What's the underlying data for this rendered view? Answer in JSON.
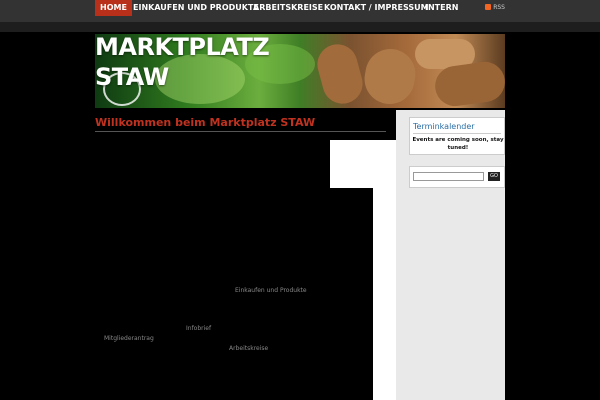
{
  "nav": {
    "items": [
      {
        "label": "HOME",
        "active": true
      },
      {
        "label": "EINKAUFEN UND PRODUKTE",
        "active": false
      },
      {
        "label": "ARBEITSKREISE",
        "active": false
      },
      {
        "label": "KONTAKT / IMPRESSUM",
        "active": false
      },
      {
        "label": "INTERN",
        "active": false
      }
    ],
    "rss_label": "RSS"
  },
  "site": {
    "title_line1": "MARKTPLATZ",
    "title_line2": "STAW"
  },
  "main": {
    "heading": "Willkommen beim Marktplatz STAW",
    "links": {
      "einkaufen": "Einkaufen und Produkte",
      "infobrief": "Infobrief",
      "mitgliederantrag": "Mitgliederantrag",
      "arbeitskreise": "Arbeitskreise"
    }
  },
  "sidebar": {
    "calendar_title": "Terminkalender",
    "calendar_text": "Events are coming soon, stay tuned!",
    "search_placeholder": "",
    "search_button": "GO"
  },
  "colors": {
    "accent": "#b8301a",
    "heading": "#c0321f",
    "widget_title": "#2a6ea5"
  }
}
